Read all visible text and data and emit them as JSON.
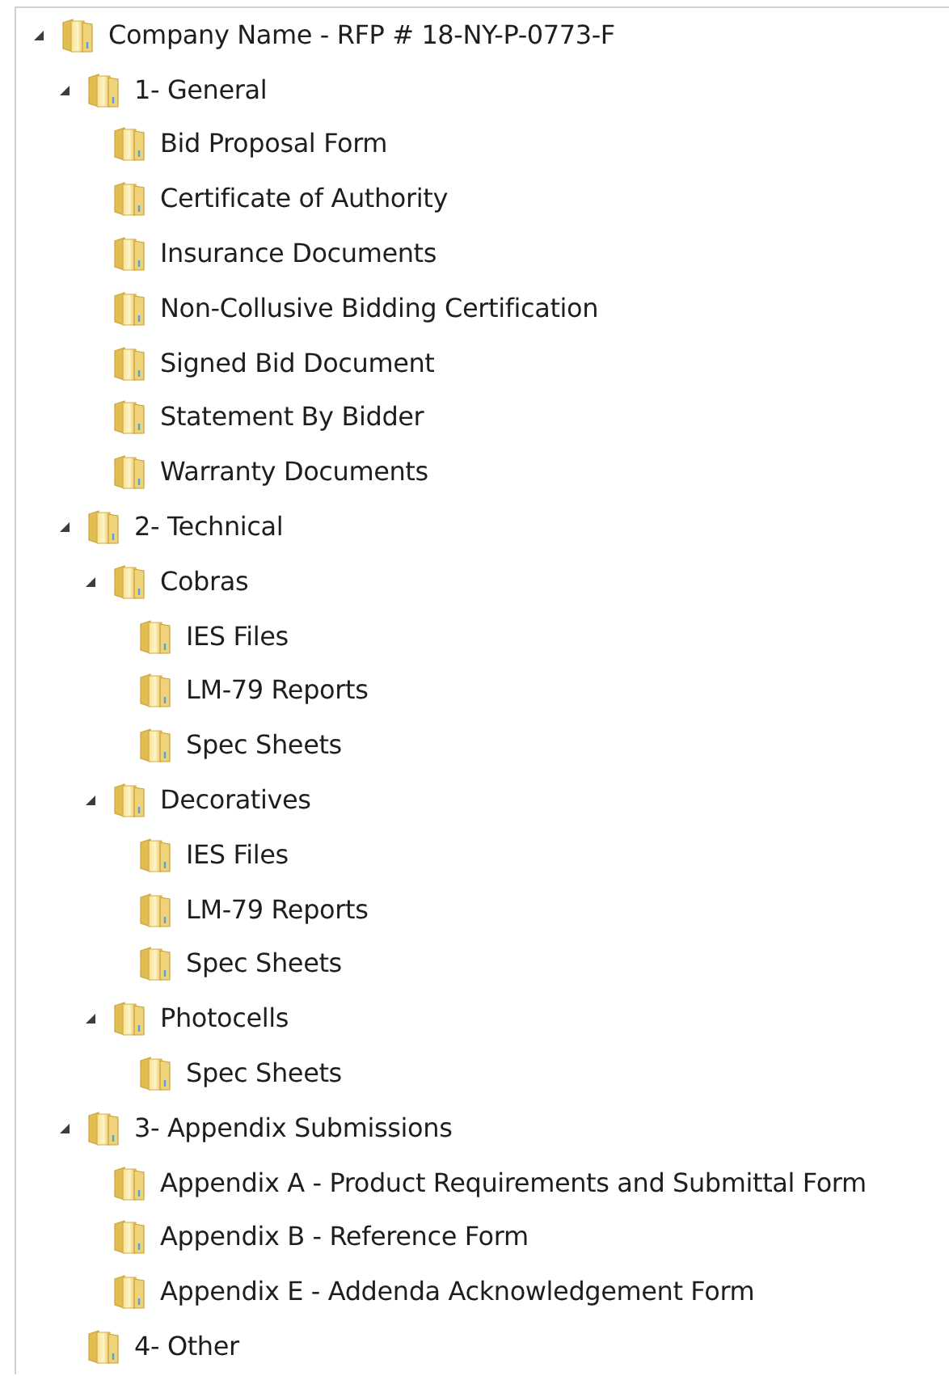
{
  "folder_tree": [
    {
      "label": "Company Name - RFP # 18-NY-P-0773-F",
      "expanded": true,
      "children": [
        {
          "label": "1- General",
          "expanded": true,
          "children": [
            {
              "label": "Bid Proposal Form"
            },
            {
              "label": "Certificate of Authority"
            },
            {
              "label": "Insurance Documents"
            },
            {
              "label": "Non-Collusive Bidding Certification"
            },
            {
              "label": "Signed Bid Document"
            },
            {
              "label": "Statement By Bidder"
            },
            {
              "label": "Warranty Documents"
            }
          ]
        },
        {
          "label": "2- Technical",
          "expanded": true,
          "children": [
            {
              "label": "Cobras",
              "expanded": true,
              "children": [
                {
                  "label": "IES Files"
                },
                {
                  "label": "LM-79 Reports"
                },
                {
                  "label": "Spec Sheets"
                }
              ]
            },
            {
              "label": "Decoratives",
              "expanded": true,
              "children": [
                {
                  "label": "IES Files"
                },
                {
                  "label": "LM-79 Reports"
                },
                {
                  "label": "Spec Sheets"
                }
              ]
            },
            {
              "label": "Photocells",
              "expanded": true,
              "children": [
                {
                  "label": "Spec Sheets"
                }
              ]
            }
          ]
        },
        {
          "label": "3- Appendix Submissions",
          "expanded": true,
          "children": [
            {
              "label": "Appendix A - Product Requirements and Submittal Form"
            },
            {
              "label": "Appendix B - Reference Form"
            },
            {
              "label": "Appendix E - Addenda Acknowledgement Form"
            }
          ]
        },
        {
          "label": "4- Other"
        }
      ]
    }
  ]
}
